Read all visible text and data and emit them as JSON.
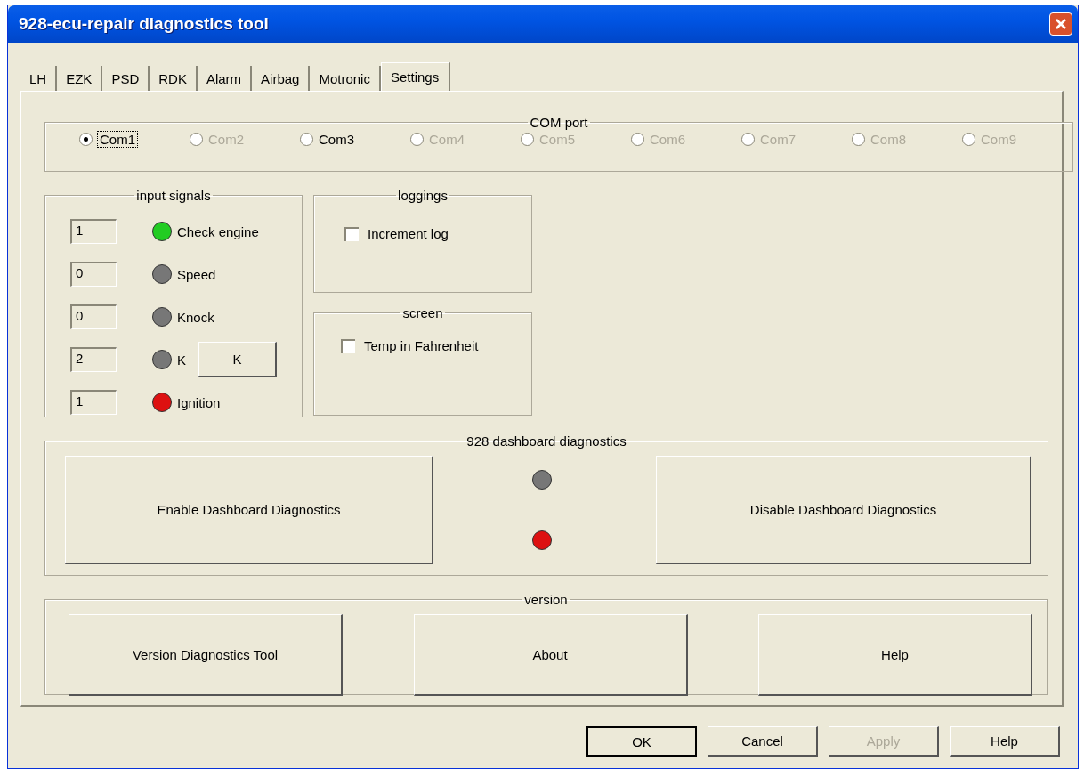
{
  "window": {
    "title": "928-ecu-repair diagnostics tool"
  },
  "tabs": [
    {
      "label": "LH",
      "selected": false
    },
    {
      "label": "EZK",
      "selected": false
    },
    {
      "label": "PSD",
      "selected": false
    },
    {
      "label": "RDK",
      "selected": false
    },
    {
      "label": "Alarm",
      "selected": false
    },
    {
      "label": "Airbag",
      "selected": false
    },
    {
      "label": "Motronic",
      "selected": false
    },
    {
      "label": "Settings",
      "selected": true
    }
  ],
  "com_port": {
    "title": "COM port",
    "options": [
      {
        "label": "Com1",
        "selected": true,
        "disabled": false
      },
      {
        "label": "Com2",
        "selected": false,
        "disabled": true
      },
      {
        "label": "Com3",
        "selected": false,
        "disabled": false
      },
      {
        "label": "Com4",
        "selected": false,
        "disabled": true
      },
      {
        "label": "Com5",
        "selected": false,
        "disabled": true
      },
      {
        "label": "Com6",
        "selected": false,
        "disabled": true
      },
      {
        "label": "Com7",
        "selected": false,
        "disabled": true
      },
      {
        "label": "Com8",
        "selected": false,
        "disabled": true
      },
      {
        "label": "Com9",
        "selected": false,
        "disabled": true
      }
    ]
  },
  "input_signals": {
    "title": "input signals",
    "rows": [
      {
        "value": "1",
        "label": "Check engine",
        "color": "#22cc22"
      },
      {
        "value": "0",
        "label": "Speed",
        "color": "#777777"
      },
      {
        "value": "0",
        "label": "Knock",
        "color": "#777777"
      },
      {
        "value": "2",
        "label": "K",
        "color": "#777777",
        "button": "K"
      },
      {
        "value": "1",
        "label": "Ignition",
        "color": "#dd1111"
      }
    ]
  },
  "loggings": {
    "title": "loggings",
    "checkbox": {
      "label": "Increment log",
      "checked": false
    }
  },
  "screen": {
    "title": "screen",
    "checkbox": {
      "label": "Temp in Fahrenheit",
      "checked": false
    }
  },
  "dashboard": {
    "title": "928 dashboard diagnostics",
    "enable_button": "Enable Dashboard Diagnostics",
    "disable_button": "Disable Dashboard Diagnostics",
    "lamps": [
      {
        "color": "#777777"
      },
      {
        "color": "#dd1111"
      }
    ]
  },
  "version": {
    "title": "version",
    "buttons": [
      "Version Diagnostics Tool",
      "About",
      "Help"
    ]
  },
  "dialog_buttons": [
    {
      "label": "OK",
      "disabled": false,
      "default": true
    },
    {
      "label": "Cancel",
      "disabled": false,
      "default": false
    },
    {
      "label": "Apply",
      "disabled": true,
      "default": false
    },
    {
      "label": "Help",
      "disabled": false,
      "default": false
    }
  ]
}
